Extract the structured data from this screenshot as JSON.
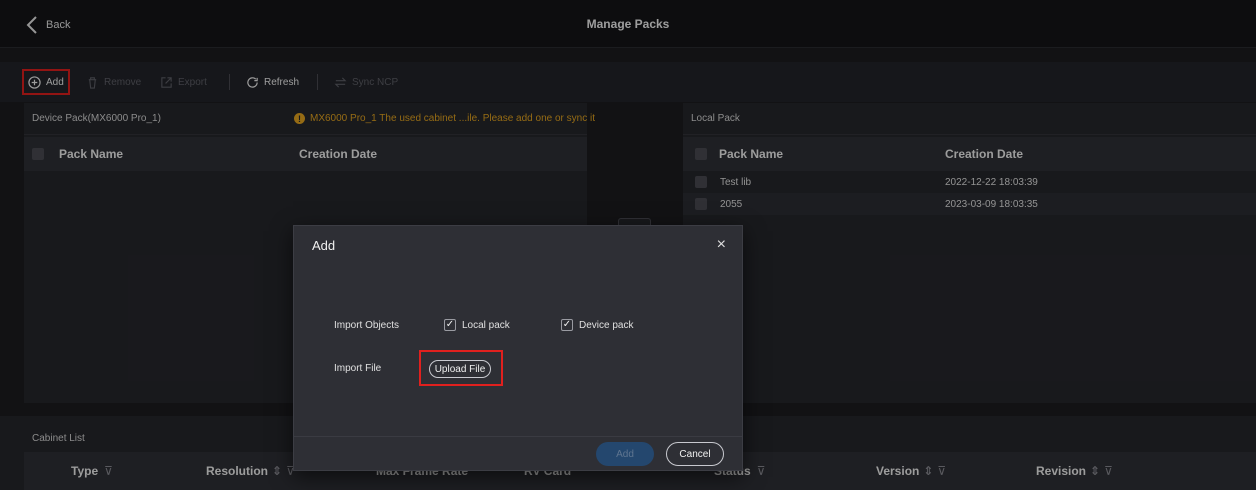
{
  "header": {
    "back_label": "Back",
    "title": "Manage Packs"
  },
  "toolbar": {
    "add": "Add",
    "remove": "Remove",
    "export": "Export",
    "refresh": "Refresh",
    "sync": "Sync NCP"
  },
  "device_panel": {
    "title": "Device Pack(MX6000 Pro_1)",
    "warning": "MX6000 Pro_1 The used cabinet ...ile. Please add one or sync it",
    "columns": [
      "Pack Name",
      "Creation Date"
    ],
    "rows": []
  },
  "local_panel": {
    "title": "Local Pack",
    "columns": [
      "Pack Name",
      "Creation Date"
    ],
    "rows": [
      {
        "name": "Test lib",
        "date": "2022-12-22 18:03:39"
      },
      {
        "name": "2055",
        "date": "2023-03-09 18:03:35"
      }
    ]
  },
  "cabinet_list": {
    "title": "Cabinet List",
    "columns": [
      "Type",
      "Resolution",
      "Max Frame Rate",
      "RV Card",
      "Status",
      "Version",
      "Revision"
    ]
  },
  "modal": {
    "title": "Add",
    "close": "×",
    "import_objects_label": "Import Objects",
    "local_pack": "Local pack",
    "device_pack": "Device pack",
    "import_file_label": "Import File",
    "upload_file": "Upload File",
    "add_button": "Add",
    "cancel_button": "Cancel"
  },
  "colors": {
    "accent_red": "#e0201e",
    "warning": "#e5a520",
    "primary_disabled": "#24476e"
  },
  "icons": [
    "chevron-left-icon",
    "plus-circle-icon",
    "trash-icon",
    "export-icon",
    "refresh-icon",
    "sync-icon",
    "warning-icon",
    "filter-icon",
    "sort-icon",
    "close-icon",
    "check-icon"
  ]
}
